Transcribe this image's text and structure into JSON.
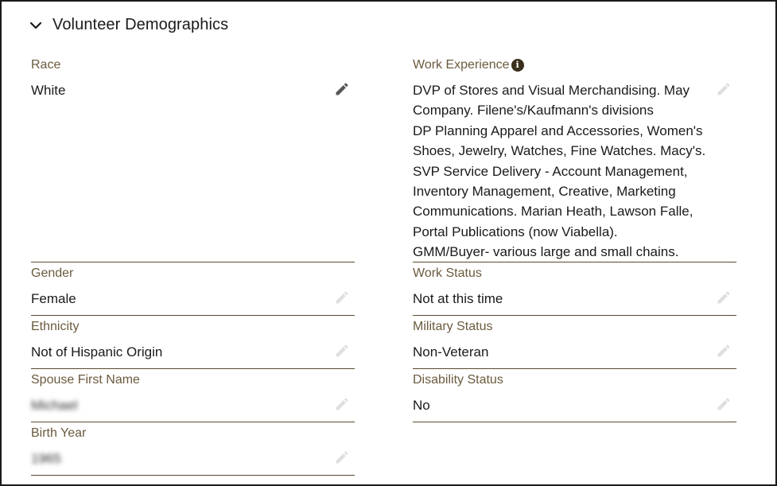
{
  "section": {
    "title": "Volunteer Demographics"
  },
  "left_fields": [
    {
      "label": "Race",
      "value": "White"
    },
    {
      "label": "Gender",
      "value": "Female"
    },
    {
      "label": "Ethnicity",
      "value": "Not of Hispanic Origin"
    },
    {
      "label": "Spouse First Name",
      "value": "Michael"
    },
    {
      "label": "Birth Year",
      "value": "1965"
    }
  ],
  "right_fields": [
    {
      "label": "Work Experience",
      "value_lines": [
        "DVP of Stores and Visual Merchandising. May",
        "Company. Filene's/Kaufmann's divisions",
        "DP Planning Apparel and Accessories, Women's",
        "Shoes, Jewelry, Watches, Fine Watches. Macy's.",
        "SVP Service Delivery - Account Management,",
        "Inventory Management, Creative, Marketing",
        "Communications. Marian Heath, Lawson Falle,",
        "Portal Publications (now Viabella).",
        "GMM/Buyer- various large and small chains."
      ]
    },
    {
      "label": "Work Status",
      "value": "Not at this time"
    },
    {
      "label": "Military Status",
      "value": "Non-Veteran"
    },
    {
      "label": "Disability Status",
      "value": "No"
    }
  ],
  "icons": {
    "collapse": "chevron-down-icon",
    "edit": "pencil-icon",
    "info": "info-icon"
  },
  "colors": {
    "label": "#6b5a3e",
    "divider": "#5a4a2f",
    "info_badge": "#3a2e1c"
  }
}
